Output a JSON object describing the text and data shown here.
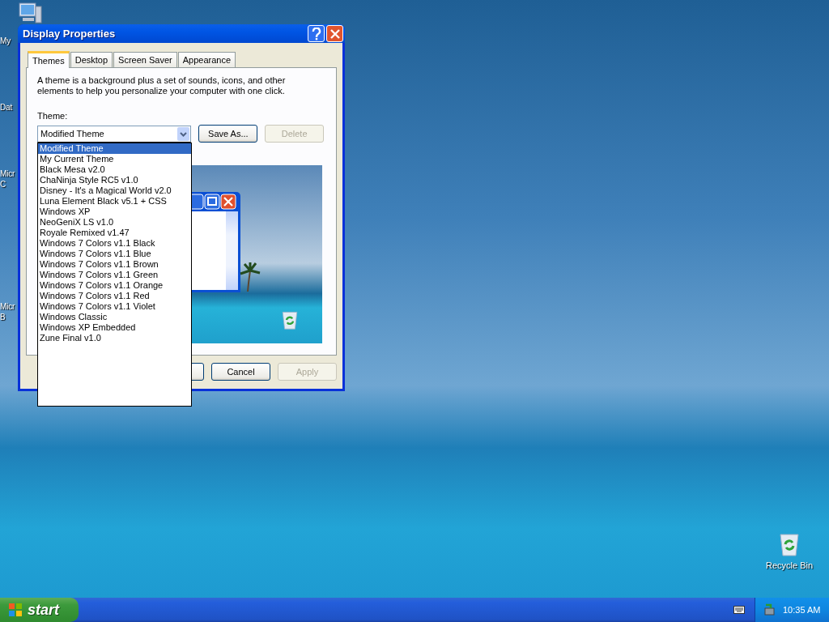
{
  "desktop_icons": [
    {
      "lines": [
        "My"
      ]
    },
    {
      "lines": [
        "Dat"
      ]
    },
    {
      "lines": [
        "Micr",
        "C"
      ]
    },
    {
      "lines": [
        "Micr",
        "B"
      ]
    }
  ],
  "recycle_bin": {
    "label": "Recycle Bin"
  },
  "window": {
    "title": "Display Properties",
    "tabs": [
      {
        "label": "Themes",
        "selected": true
      },
      {
        "label": "Desktop",
        "selected": false
      },
      {
        "label": "Screen Saver",
        "selected": false
      },
      {
        "label": "Appearance",
        "selected": false
      }
    ],
    "description": "A theme is a background plus a set of sounds, icons, and other elements to help you personalize your computer with one click.",
    "theme_label": "Theme:",
    "theme_combo": {
      "value": "Modified Theme",
      "expanded": true
    },
    "side_buttons": [
      {
        "label": "Save As...",
        "disabled": false
      },
      {
        "label": "Delete",
        "disabled": true
      }
    ],
    "theme_list": [
      {
        "label": "Modified Theme",
        "selected": true
      },
      {
        "label": "My Current Theme",
        "selected": false
      },
      {
        "label": "Black Mesa v2.0",
        "selected": false
      },
      {
        "label": "ChaNinja Style RC5 v1.0",
        "selected": false
      },
      {
        "label": "Disney - It's a Magical World v2.0",
        "selected": false
      },
      {
        "label": "Luna Element Black v5.1 + CSS",
        "selected": false
      },
      {
        "label": "Windows XP",
        "selected": false
      },
      {
        "label": "NeoGeniX LS v1.0",
        "selected": false
      },
      {
        "label": "Royale Remixed v1.47",
        "selected": false
      },
      {
        "label": "Windows 7 Colors v1.1 Black",
        "selected": false
      },
      {
        "label": "Windows 7 Colors v1.1 Blue",
        "selected": false
      },
      {
        "label": "Windows 7 Colors v1.1 Brown",
        "selected": false
      },
      {
        "label": "Windows 7 Colors v1.1 Green",
        "selected": false
      },
      {
        "label": "Windows 7 Colors v1.1 Orange",
        "selected": false
      },
      {
        "label": "Windows 7 Colors v1.1 Red",
        "selected": false
      },
      {
        "label": "Windows 7 Colors v1.1 Violet",
        "selected": false
      },
      {
        "label": "Windows Classic",
        "selected": false
      },
      {
        "label": "Windows XP Embedded",
        "selected": false
      },
      {
        "label": "Zune Final v1.0",
        "selected": false
      }
    ],
    "buttons": [
      {
        "label": "Cancel",
        "disabled": false
      },
      {
        "label": "Apply",
        "disabled": true
      }
    ]
  },
  "taskbar": {
    "start": "start",
    "clock": "10:35 AM"
  }
}
